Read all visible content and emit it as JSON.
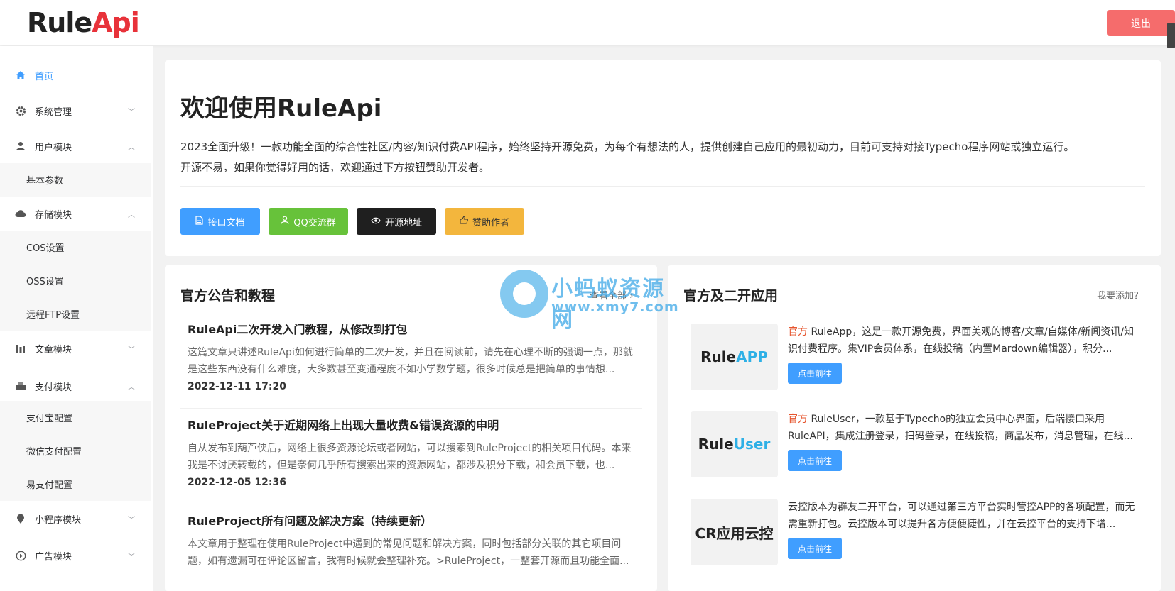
{
  "header": {
    "logo_part1": "Rule",
    "logo_part2": "Api",
    "logout_label": "退出"
  },
  "sidebar": {
    "items": [
      {
        "label": "首页",
        "icon": "home-icon"
      },
      {
        "label": "系统管理",
        "icon": "gear-icon"
      },
      {
        "label": "用户模块",
        "icon": "user-icon"
      },
      {
        "label": "基本参数"
      },
      {
        "label": "存储模块",
        "icon": "cloud-icon"
      },
      {
        "label": "COS设置"
      },
      {
        "label": "OSS设置"
      },
      {
        "label": "远程FTP设置"
      },
      {
        "label": "文章模块",
        "icon": "chart-icon"
      },
      {
        "label": "支付模块",
        "icon": "wallet-icon"
      },
      {
        "label": "支付宝配置"
      },
      {
        "label": "微信支付配置"
      },
      {
        "label": "易支付配置"
      },
      {
        "label": "小程序模块",
        "icon": "location-icon"
      },
      {
        "label": "广告模块",
        "icon": "play-icon"
      }
    ]
  },
  "welcome": {
    "title": "欢迎使用RuleApi",
    "intro_line1": "2023全面升级！一款功能全面的综合性社区/内容/知识付费API程序，始终坚持开源免费，为每个有想法的人，提供创建自己应用的最初动力，目前可支持对接Typecho程序网站或独立运行。",
    "intro_line2": "开源不易，如果你觉得好用的话，欢迎通过下方按钮赞助开发者。",
    "buttons": [
      {
        "label": "接口文档",
        "color": "#409eff"
      },
      {
        "label": "QQ交流群",
        "color": "#67c23a"
      },
      {
        "label": "开源地址",
        "color": "#1f1f1f"
      },
      {
        "label": "赞助作者",
        "color": "#f3b63d"
      }
    ]
  },
  "notice": {
    "title": "官方公告和教程",
    "view_all": "查看全部",
    "articles": [
      {
        "title": "RuleApi二次开发入门教程，从修改到打包",
        "summary": "这篇文章只讲述RuleApi如何进行简单的二次开发，并且在阅读前，请先在心理不断的强调一点，那就是这些东西没有什么难度，大多数甚至变通程度不如小学数学题，很多时候总是把简单的事情想...",
        "date": "2022-12-11 17:20"
      },
      {
        "title": "RuleProject关于近期网络上出现大量收费&错误资源的申明",
        "summary": "自从发布到葫芦侠后，网络上很多资源论坛或者网站，可以搜索到RuleProject的相关项目代码。本来我是不讨厌转载的，但是奈何几乎所有搜索出来的资源网站，都涉及积分下载，和会员下载，也...",
        "date": "2022-12-05 12:36"
      },
      {
        "title": "RuleProject所有问题及解决方案（持续更新）",
        "summary": "本文章用于整理在使用RuleProject中遇到的常见问题和解决方案，同时包括部分关联的其它项目问题，如有遗漏可在评论区留言，我有时候就会整理补充。>RuleProject，一整套开源而且功能全面...",
        "date": ""
      }
    ]
  },
  "apps": {
    "title": "官方及二开应用",
    "add_link": "我要添加？",
    "go_label": "点击前往",
    "items": [
      {
        "logo_main": "Rule",
        "logo_accent": "APP",
        "tag": "官方",
        "desc": " RuleApp，这是一款开源免费，界面美观的博客/文章/自媒体/新闻资讯/知识付费程序。集VIP会员体系，在线投稿（内置Mardown编辑器），积分..."
      },
      {
        "logo_main": "Rule",
        "logo_accent": "User",
        "tag": "官方",
        "desc": " RuleUser，一款基于Typecho的独立会员中心界面，后端接口采用RuleAPI，集成注册登录，扫码登录，在线投稿，商品发布，消息管理，在线..."
      },
      {
        "logo_main": "CR应用云控",
        "logo_accent": "",
        "tag": "",
        "desc": "云控版本为群友二开平台，可以通过第三方平台实时管控APP的各项配置，而无需重新打包。云控版本可以提升各方便便捷性，并在云控平台的支持下增..."
      }
    ]
  },
  "watermark": {
    "line1": "小蚂蚁资源网",
    "line2": "www.xmy7.com"
  }
}
